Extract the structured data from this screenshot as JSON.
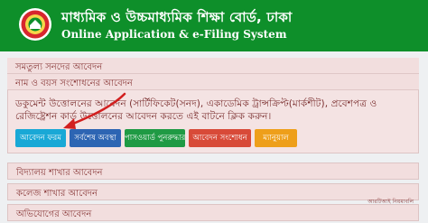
{
  "header": {
    "title_bn": "মাধ্যমিক ও উচ্চমাধ্যমিক শিক্ষা বোর্ড, ঢাকা",
    "title_en": "Online Application & e-Filing System",
    "logo_icon": "board-seal-icon"
  },
  "sections": [
    {
      "label": "সমতুল্য সনদের আবেদন"
    },
    {
      "label": "নাম ও বয়স সংশোধনের আবেদন"
    }
  ],
  "document_info": "ডকুমেন্ট উত্তোলনের আবেদন (সার্টিফিকেট(সনদ), একাডেমিক ট্রান্সক্রিপ্ট(মার্কশীট), প্রবেশপত্র ও রেজিষ্ট্রেশন কার্ড উত্তোলনের আবেদন করতে এই বাটনে ক্লিক করুন।",
  "buttons": [
    {
      "label": "আবেদন ফরম",
      "color": "#19a8d6"
    },
    {
      "label": "সর্বশেষ অবস্থা",
      "color": "#2d65b3"
    },
    {
      "label": "পাসওয়ার্ড পুনরুদ্ধার",
      "color": "#1f9a44"
    },
    {
      "label": "আবেদন সংশোধন",
      "color": "#d84a38"
    },
    {
      "label": "ম্যানুয়াল",
      "color": "#ee9f1a"
    }
  ],
  "lower_sections": [
    {
      "label": "বিদ্যালয় শাখার আবেদন"
    },
    {
      "label": "কলেজ শাখার আবেদন"
    },
    {
      "label": "অভিযোগের আবেদন"
    }
  ],
  "footer_note": "আরটিআই নিয়মাবলি",
  "colors": {
    "header_green": "#0e8f2a",
    "panel_bg": "#f2dede",
    "panel_text": "#8a3a3a",
    "annotation_arrow": "#d21f1f"
  }
}
